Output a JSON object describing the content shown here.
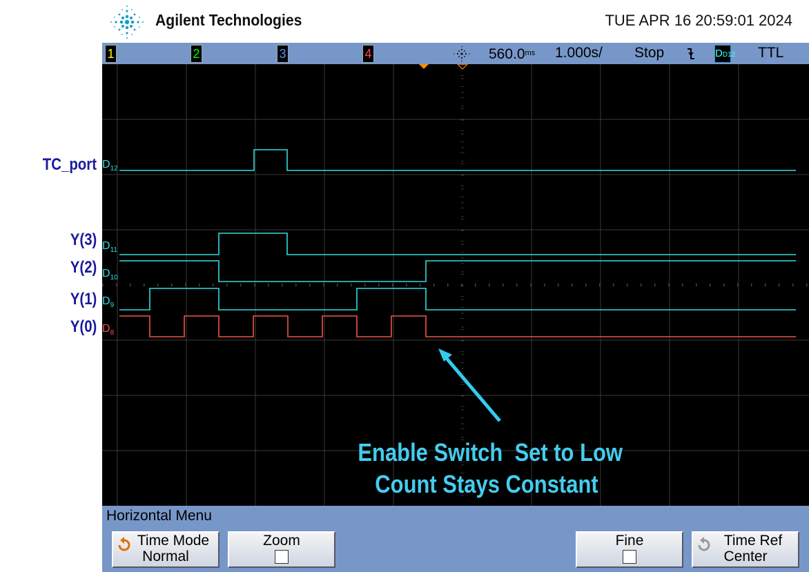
{
  "header": {
    "brand": "Agilent Technologies",
    "datetime": "TUE APR 16 20:59:01 2024",
    "logo_icon": "agilent-spark-icon"
  },
  "status_bar": {
    "channels": [
      {
        "label": "1",
        "color": "#ffff00"
      },
      {
        "label": "2",
        "color": "#00ff00"
      },
      {
        "label": "3",
        "color": "#3366ff"
      },
      {
        "label": "4",
        "color": "#ff4444"
      }
    ],
    "delay": "560.0",
    "delay_unit": "ms",
    "timebase": "1.000s/",
    "run_state": "Stop",
    "trigger_slope": "falling-edge-icon",
    "trigger_source": "D12",
    "trigger_level": "TTL"
  },
  "signals": [
    {
      "name": "TC_port",
      "digital": "D12",
      "color": "#33dddd"
    },
    {
      "name": "Y(3)",
      "digital": "D11",
      "color": "#33dddd"
    },
    {
      "name": "Y(2)",
      "digital": "D10",
      "color": "#33dddd"
    },
    {
      "name": "Y(1)",
      "digital": "D9",
      "color": "#33dddd"
    },
    {
      "name": "Y(0)",
      "digital": "D8",
      "color": "#ee5544"
    }
  ],
  "annotation": {
    "line1": "Enable Switch  Set to Low",
    "line2": "Count Stays Constant",
    "color": "#44ccee"
  },
  "menu": {
    "title": "Horizontal Menu",
    "keys": {
      "time_mode_label": "Time Mode",
      "time_mode_value": "Normal",
      "zoom_label": "Zoom",
      "fine_label": "Fine",
      "time_ref_label": "Time Ref",
      "time_ref_value": "Center"
    }
  }
}
